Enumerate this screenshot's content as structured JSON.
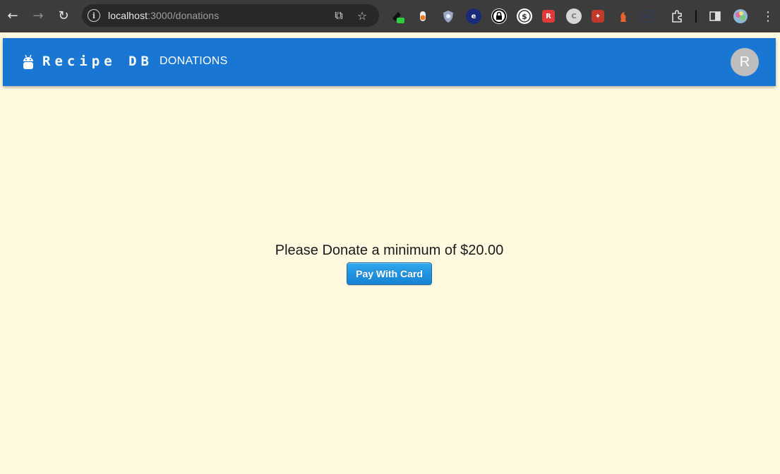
{
  "browser": {
    "url_host": "localhost",
    "url_path": ":3000/donations",
    "icons": {
      "back": "back-arrow-icon",
      "forward": "forward-arrow-icon",
      "reload": "reload-icon",
      "site_info": "site-info-icon",
      "open_external": "open-in-new-icon",
      "bookmark": "star-icon",
      "extensions": "puzzle-icon",
      "side_panel": "side-panel-icon",
      "menu": "kebab-menu-icon"
    }
  },
  "app": {
    "brand": "Recipe DB",
    "nav_donations": "DONATIONS",
    "avatar_initial": "R",
    "colors": {
      "appbar": "#1976d2",
      "page_bg": "#fff9e0",
      "avatar": "#bdbdbd"
    }
  },
  "donation": {
    "message": "Please Donate a minimum of $20.00",
    "pay_button_label": "Pay With Card"
  }
}
